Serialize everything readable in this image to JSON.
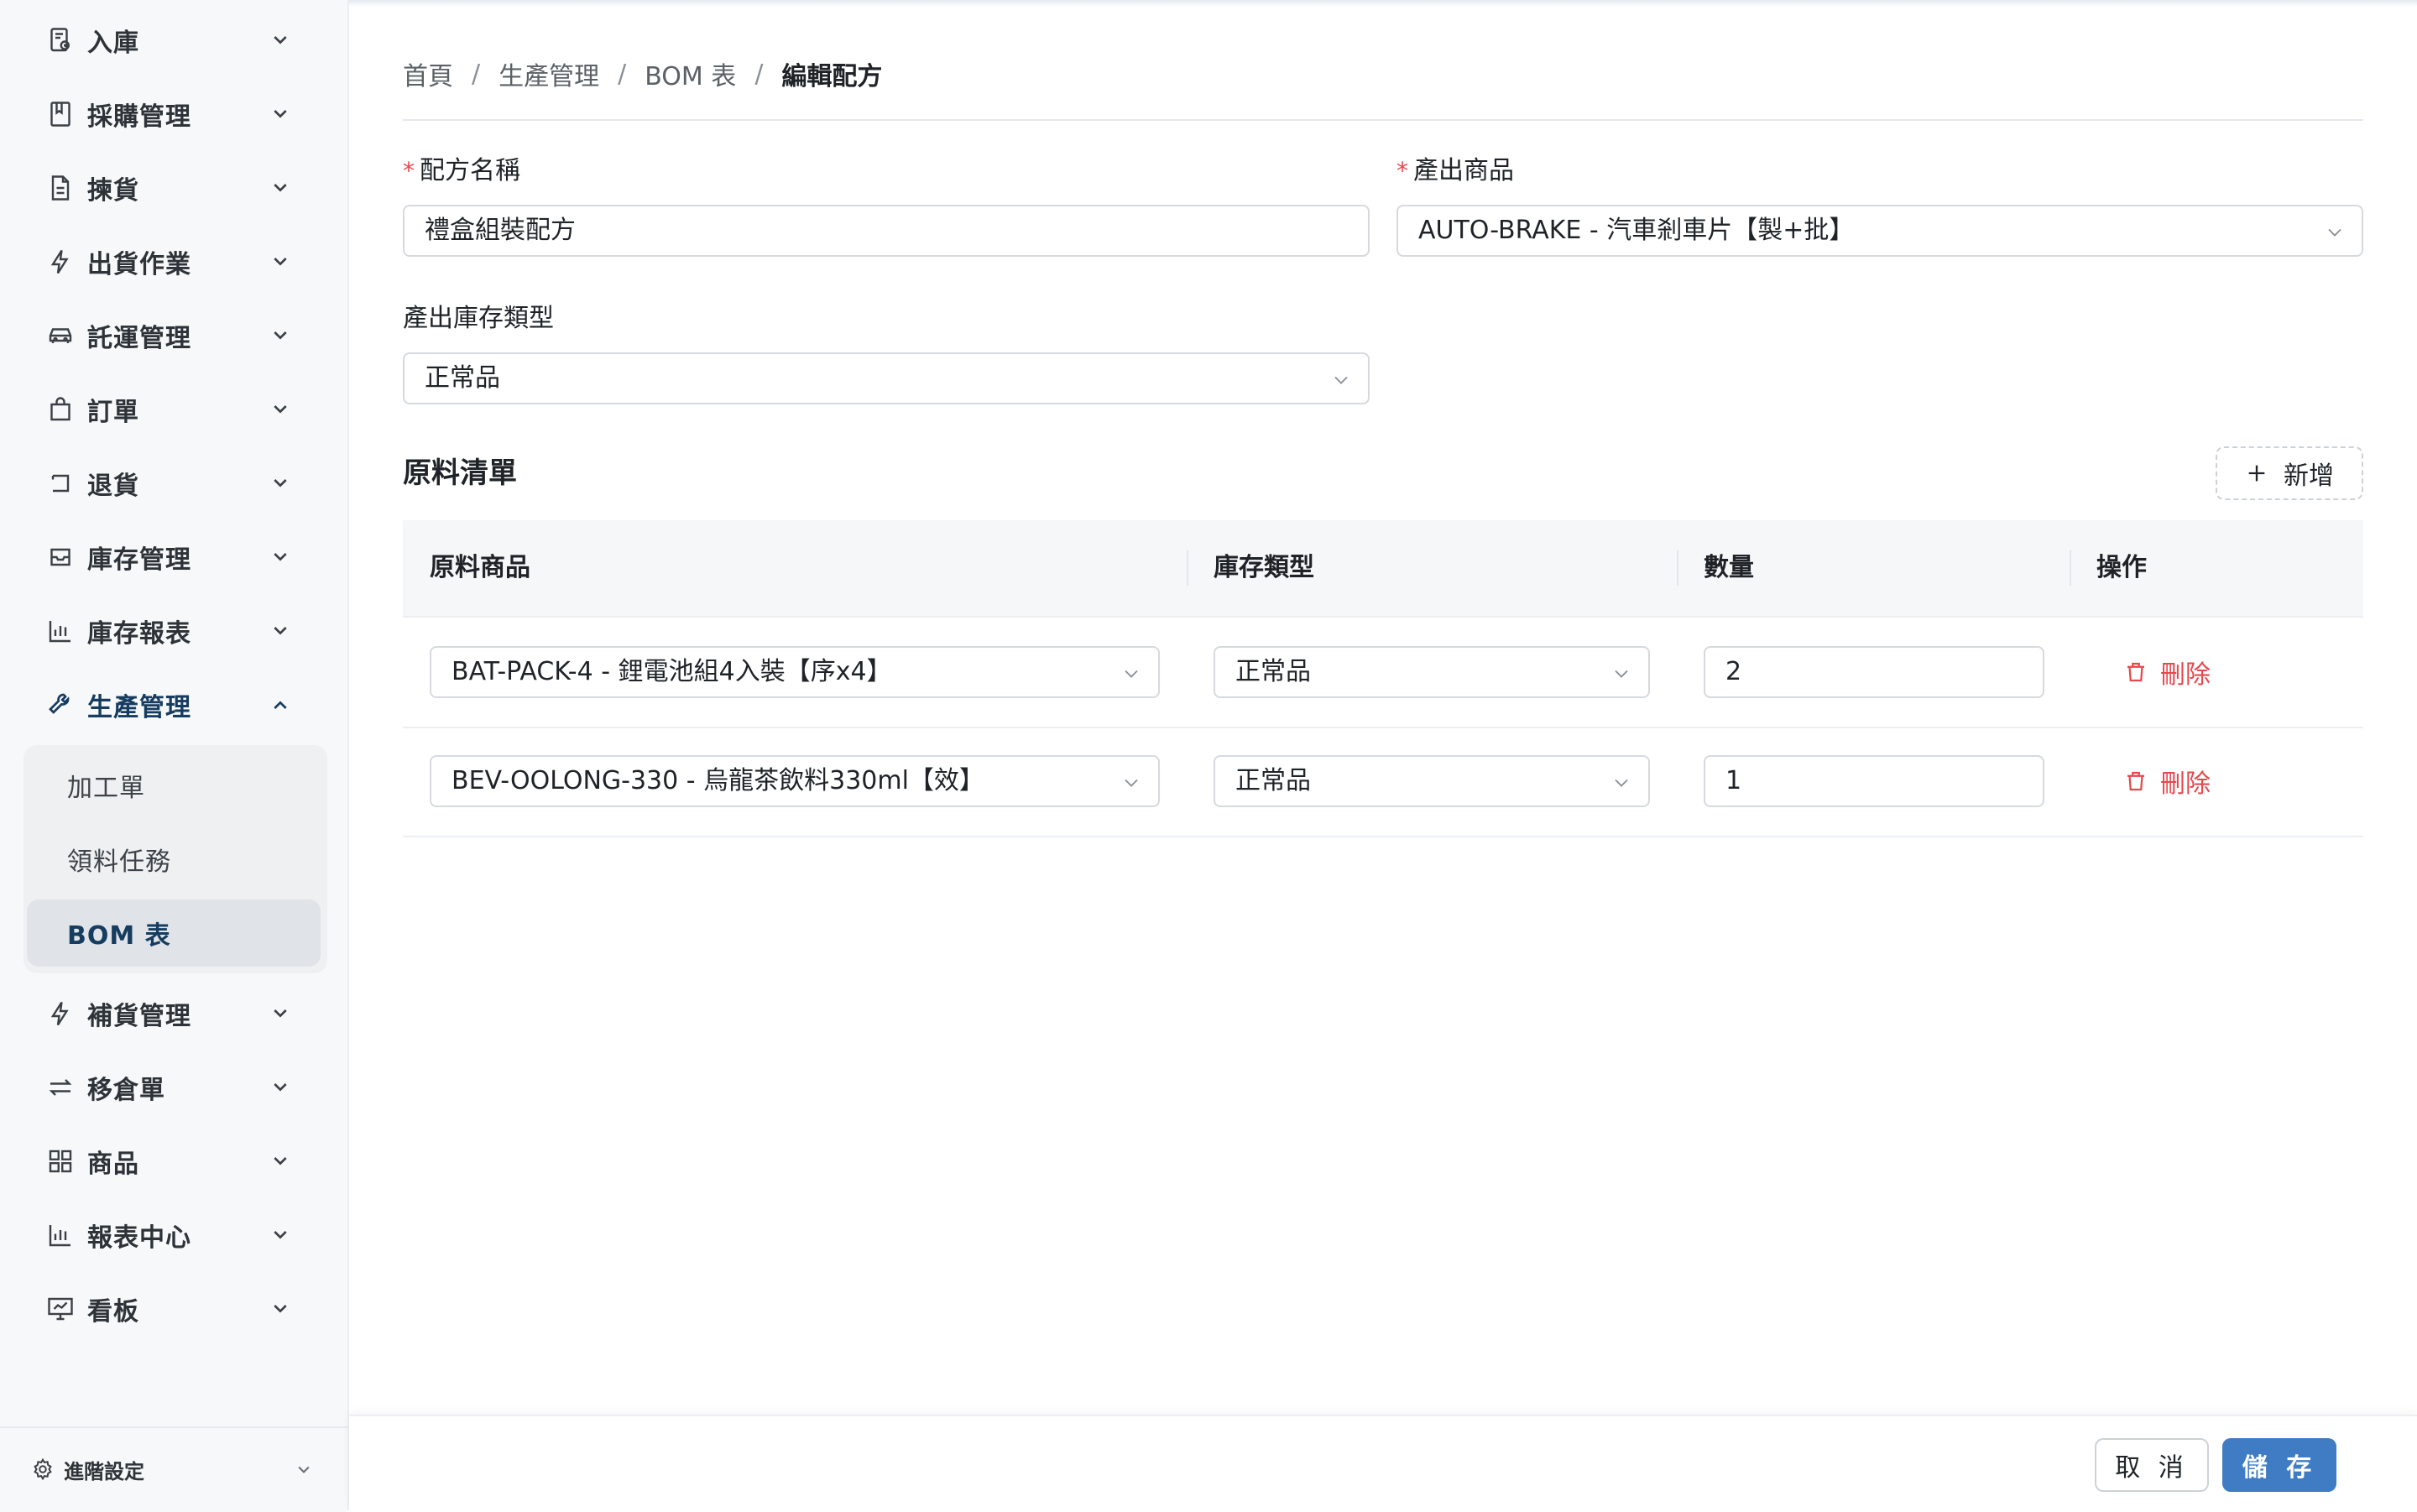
{
  "sidebar": {
    "items": [
      {
        "label": "入庫",
        "icon": "inbound-doc-icon"
      },
      {
        "label": "採購管理",
        "icon": "book-icon"
      },
      {
        "label": "揀貨",
        "icon": "document-icon"
      },
      {
        "label": "出貨作業",
        "icon": "lightning-icon"
      },
      {
        "label": "託運管理",
        "icon": "car-icon"
      },
      {
        "label": "訂單",
        "icon": "shopping-bag-icon"
      },
      {
        "label": "退貨",
        "icon": "return-arrow-icon"
      },
      {
        "label": "庫存管理",
        "icon": "inbox-icon"
      },
      {
        "label": "庫存報表",
        "icon": "bar-chart-icon"
      },
      {
        "label": "生產管理",
        "icon": "wrench-icon"
      },
      {
        "label": "補貨管理",
        "icon": "lightning-icon"
      },
      {
        "label": "移倉單",
        "icon": "swap-arrows-icon"
      },
      {
        "label": "商品",
        "icon": "grid-icon"
      },
      {
        "label": "報表中心",
        "icon": "bar-chart-icon"
      },
      {
        "label": "看板",
        "icon": "presentation-board-icon"
      }
    ],
    "active_item": "生產管理",
    "submenu": [
      "加工單",
      "領料任務",
      "BOM 表"
    ],
    "active_submenu": "BOM 表",
    "footer_label": "進階設定"
  },
  "breadcrumb": [
    "首頁",
    "生產管理",
    "BOM 表",
    "編輯配方"
  ],
  "form": {
    "recipe_name_label": "配方名稱",
    "recipe_name_value": "禮盒組裝配方",
    "output_product_label": "產出商品",
    "output_product_value": "AUTO-BRAKE - 汽車剎車片【製+批】",
    "output_stock_type_label": "產出庫存類型",
    "output_stock_type_value": "正常品"
  },
  "materials": {
    "title": "原料清單",
    "add_label": "新增",
    "columns": [
      "原料商品",
      "庫存類型",
      "數量",
      "操作"
    ],
    "rows": [
      {
        "product": "BAT-PACK-4 - 鋰電池組4入裝【序x4】",
        "stock_type": "正常品",
        "quantity": "2",
        "action": "刪除"
      },
      {
        "product": "BEV-OOLONG-330 - 烏龍茶飲料330ml【效】",
        "stock_type": "正常品",
        "quantity": "1",
        "action": "刪除"
      }
    ]
  },
  "footer": {
    "cancel_label": "取 消",
    "save_label": "儲 存"
  },
  "colors": {
    "accent": "#3f7cc4",
    "active_nav": "#163c60",
    "danger": "#e5484d",
    "required": "#e5484d"
  }
}
